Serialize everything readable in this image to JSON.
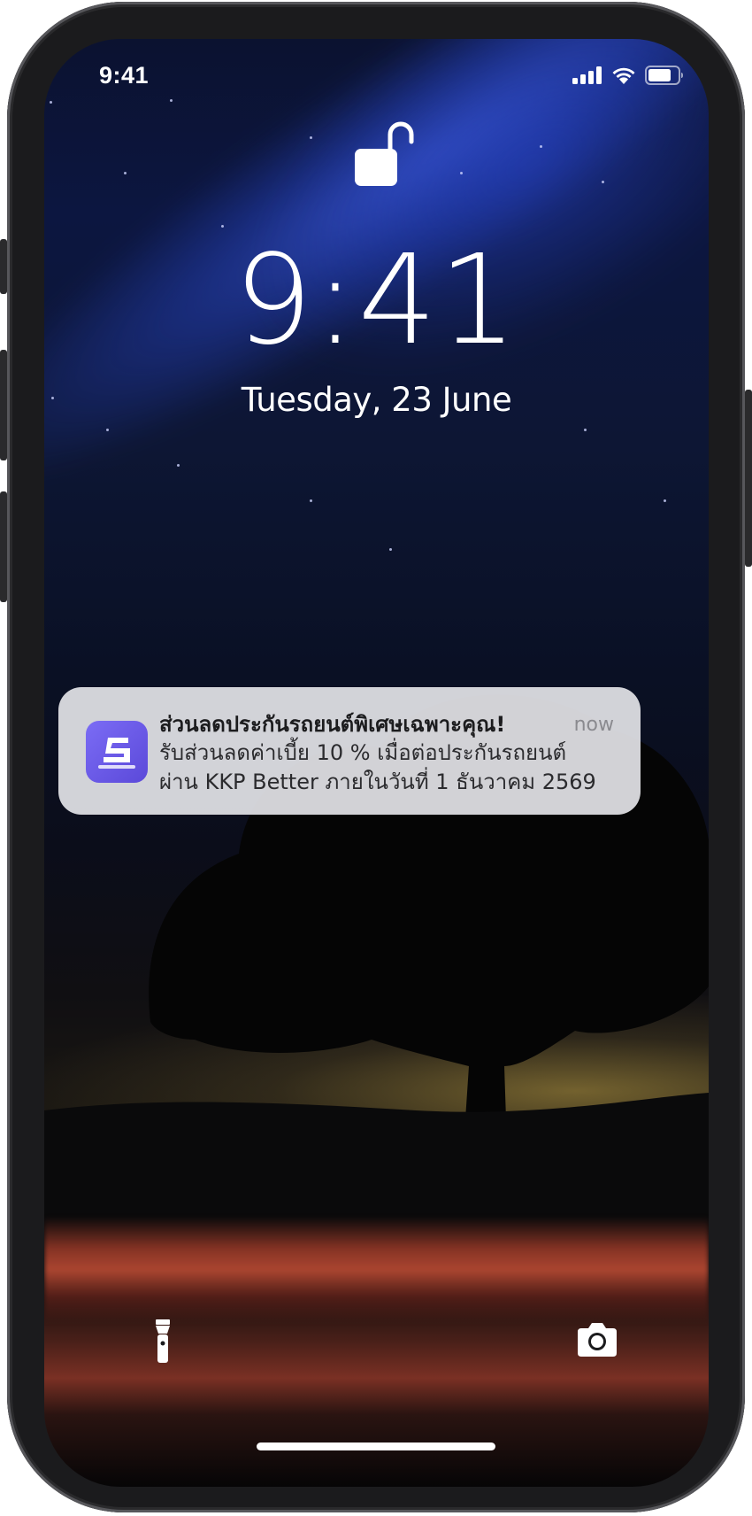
{
  "status_bar": {
    "time": "9:41",
    "signal_icon": "cellular-signal-icon",
    "wifi_icon": "wifi-icon",
    "battery_icon": "battery-icon"
  },
  "lock_screen": {
    "lock_icon": "unlocked-padlock-icon",
    "clock": "9:41",
    "date": "Tuesday,  23 June"
  },
  "notification": {
    "app_icon": "kkp-better-app-icon",
    "title": "ส่วนลดประกันรถยนต์พิเศษเฉพาะคุณ!",
    "time": "now",
    "body_line1": "รับส่วนลดค่าเบี้ย 10 % เมื่อต่อประกันรถยนต์",
    "body_line2": "ผ่าน KKP Better ภายในวันที่ 1 ธันวาคม 2569",
    "accent_color": "#6b5ce7"
  },
  "bottom_controls": {
    "flashlight_icon": "flashlight-icon",
    "camera_icon": "camera-icon"
  }
}
